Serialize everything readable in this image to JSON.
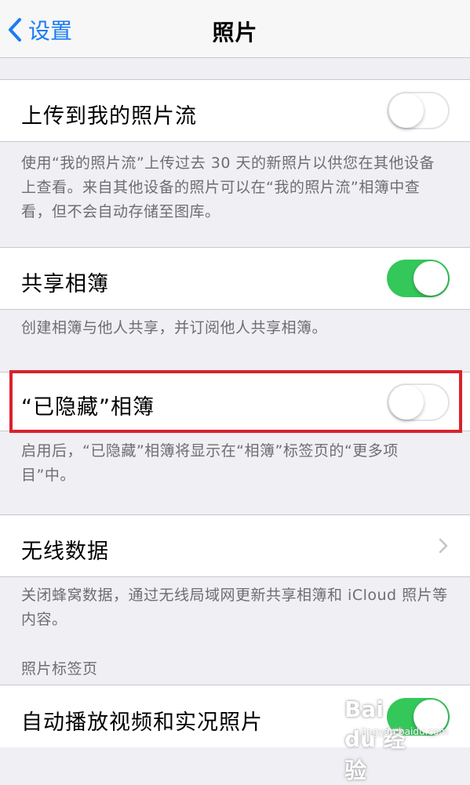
{
  "nav": {
    "back_label": "设置",
    "title": "照片"
  },
  "rows": {
    "photo_stream": {
      "label": "上传到我的照片流",
      "toggle": "off"
    },
    "shared_albums": {
      "label": "共享相簿",
      "toggle": "on"
    },
    "hidden_album": {
      "label": "“已隐藏”相簿",
      "toggle": "off"
    },
    "wireless_data": {
      "label": "无线数据"
    },
    "autoplay": {
      "label": "自动播放视频和实况照片",
      "toggle": "on"
    }
  },
  "footers": {
    "photo_stream": "使用“我的照片流”上传过去 30 天的新照片以供您在其他设备上查看。来自其他设备的照片可以在“我的照片流”相簿中查看，但不会自动存储至图库。",
    "shared_albums": "创建相簿与他人共享，并订阅他人共享相簿。",
    "hidden_album": "启用后，“已隐藏”相簿将显示在“相簿”标签页的“更多项目”中。",
    "wireless_data": "关闭蜂窝数据，通过无线局域网更新共享相簿和 iCloud 照片等内容。"
  },
  "section_headers": {
    "photos_tab": "照片标签页"
  },
  "watermark": {
    "logo_text": "Bai du 经验",
    "url_text": "jingyan.baidu.com"
  },
  "colors": {
    "accent": "#1a7cf5",
    "toggle_on": "#34c759",
    "highlight": "#d9222a",
    "background": "#efeff4"
  },
  "icons": {
    "back": "chevron-left-icon",
    "disclosure": "chevron-right-icon"
  }
}
